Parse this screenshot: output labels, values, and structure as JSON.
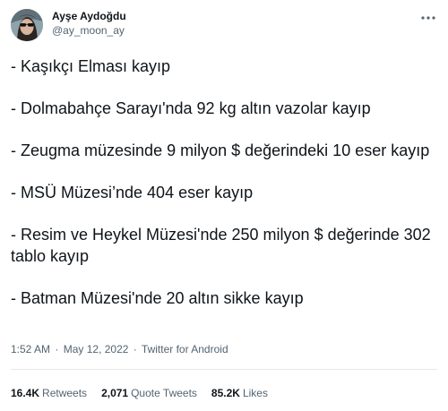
{
  "author": {
    "display_name": "Ayşe Aydoğdu",
    "handle": "@ay_moon_ay",
    "avatar_icon": "profile-avatar"
  },
  "more_icon": "more-dots-icon",
  "tweet": {
    "paragraphs": [
      "- Kaşıkçı Elması kayıp",
      "- Dolmabahçe Sarayı'nda 92 kg altın vazolar kayıp",
      "- Zeugma müzesinde 9 milyon $ değerindeki 10 eser kayıp",
      "- MSÜ Müzesi’nde 404 eser kayıp",
      "- Resim ve Heykel Müzesi'nde 250 milyon $ değerinde 302 tablo kayıp",
      "- Batman Müzesi'nde 20 altın sikke kayıp"
    ]
  },
  "meta": {
    "time": "1:52 AM",
    "separator": "·",
    "date": "May 12, 2022",
    "source": "Twitter for Android"
  },
  "stats": {
    "retweets_count": "16.4K",
    "retweets_label": "Retweets",
    "quotes_count": "2,071",
    "quotes_label": "Quote Tweets",
    "likes_count": "85.2K",
    "likes_label": "Likes"
  },
  "colors": {
    "text_primary": "#0f1419",
    "text_secondary": "#536471",
    "divider": "#e1e8ed"
  }
}
